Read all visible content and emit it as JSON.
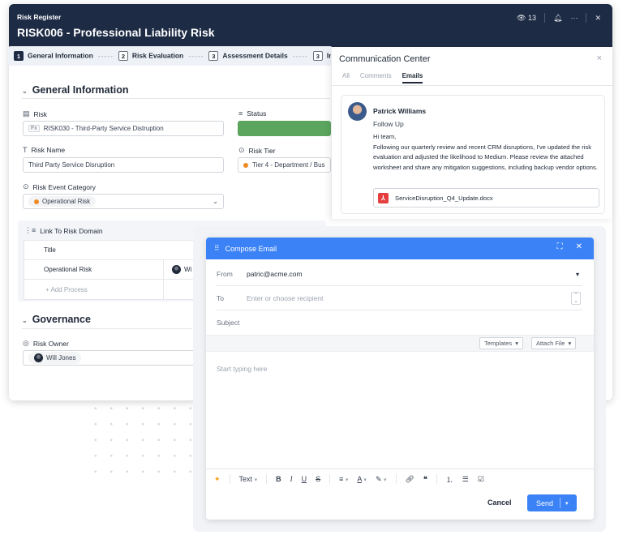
{
  "header": {
    "subtitle": "Risk Register",
    "title": "RISK006 - Professional Liability Risk",
    "count": "13"
  },
  "steps": [
    {
      "num": "1",
      "label": "General Information"
    },
    {
      "num": "2",
      "label": "Risk Evaluation"
    },
    {
      "num": "3",
      "label": "Assessment Details"
    },
    {
      "num": "3",
      "label": "In"
    }
  ],
  "general": {
    "section_title": "General Information",
    "risk_label": "Risk",
    "risk_value": "RISK030 - Third-Party Service Distruption",
    "risk_fx": "Fx",
    "status_label": "Status",
    "risk_name_label": "Risk Name",
    "risk_name_value": "Third Party Service Disruption",
    "risk_tier_label": "Risk Tier",
    "risk_tier_value": "Tier 4 - Department / Bus",
    "event_category_label": "Risk Event Category",
    "event_category_value": "Operational Risk"
  },
  "domain": {
    "label": "Link To Risk Domain",
    "col_title": "Title",
    "row_title": "Operational Risk",
    "row_owner": "Wi",
    "add_process": "+ Add Process"
  },
  "governance": {
    "section_title": "Governance",
    "owner_label": "Risk Owner",
    "owner_value": "Will Jones"
  },
  "comm": {
    "title": "Communication Center",
    "tabs": [
      "All",
      "Comments",
      "Emails"
    ],
    "active_tab": "Emails",
    "sender": "Patrick Williams",
    "subject": "Follow Up",
    "greeting": "Hi team,",
    "body": "Following our quarterly review and recent CRM disruptions, I've updated the risk evaluation and adjusted the likelihood to Medium. Please review the attached worksheet and share any mitigation suggestions, including backup vendor options.",
    "attachment": "ServiceDisruption_Q4_Update.docx"
  },
  "compose": {
    "title": "Compose Email",
    "from_label": "From",
    "from_value": "patric@acme.com",
    "to_label": "To",
    "to_placeholder": "Enter or choose recipient",
    "subject_label": "Subject",
    "templates": "Templates",
    "attach_file": "Attach File",
    "body_placeholder": "Start typing here",
    "text_style": "Text",
    "cancel": "Cancel",
    "send": "Send"
  }
}
